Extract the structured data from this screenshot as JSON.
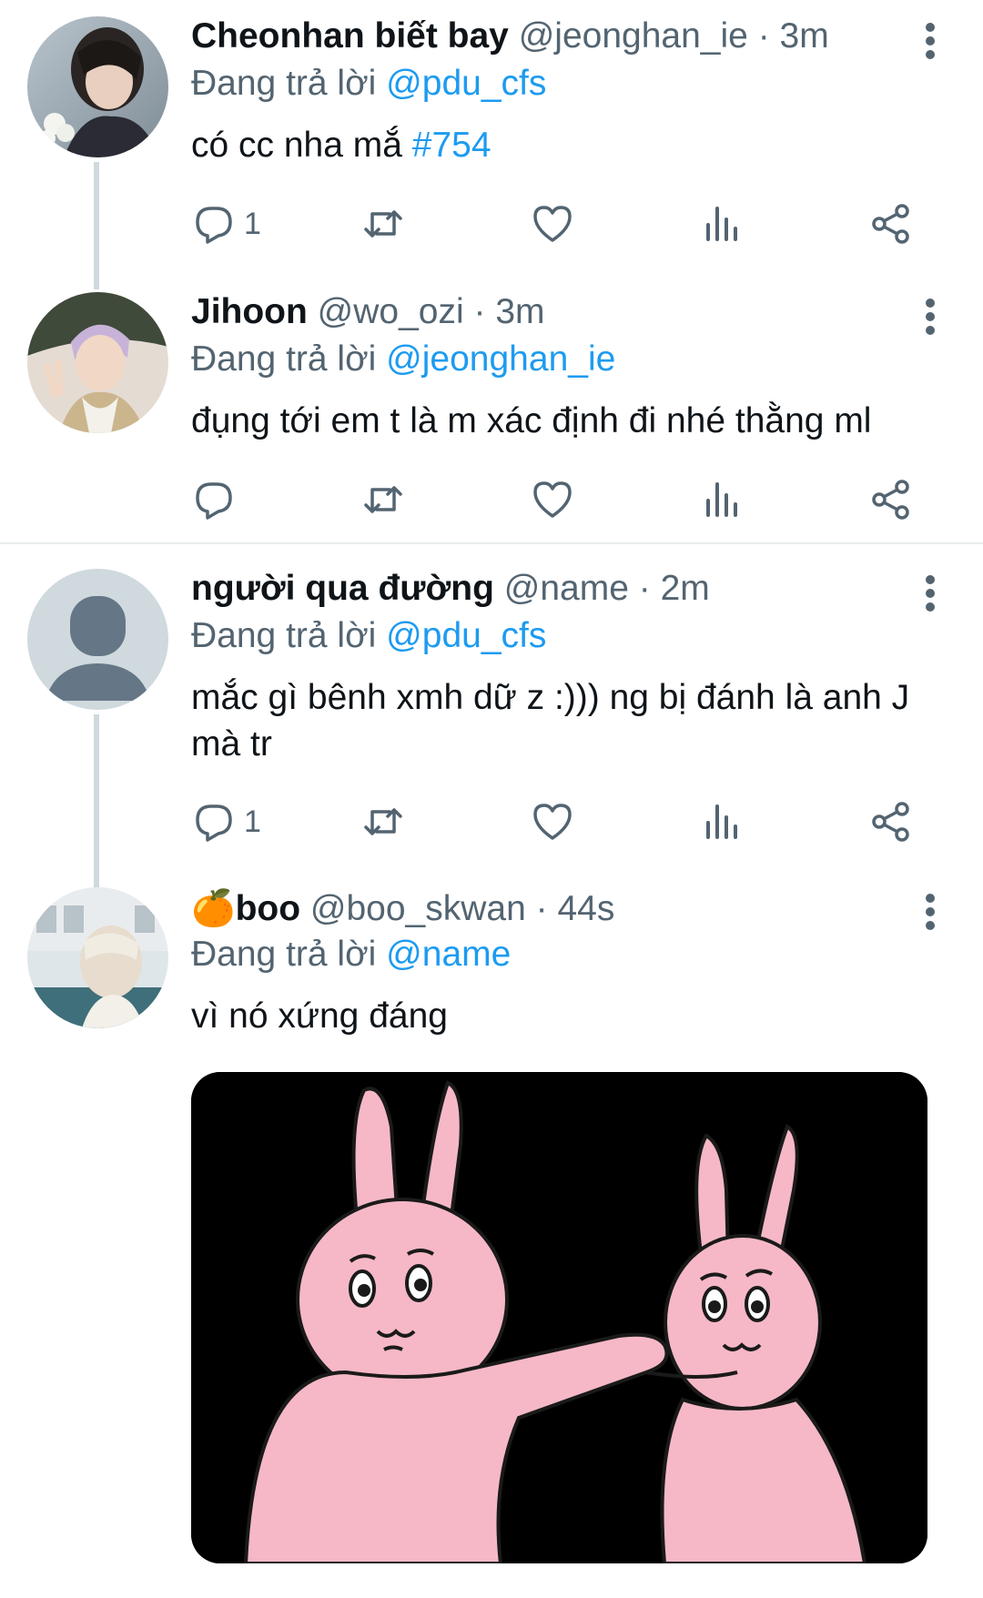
{
  "tweets": [
    {
      "display_name": "Cheonhan biết bay",
      "handle": "@jeonghan_ie",
      "time": "3m",
      "reply_prefix": "Đang trả lời",
      "reply_to": "@pdu_cfs",
      "text": "có cc nha mắ",
      "hashtag": "#754",
      "reply_count": "1"
    },
    {
      "display_name": "Jihoon",
      "handle": "@wo_ozi",
      "time": "3m",
      "reply_prefix": "Đang trả lời",
      "reply_to": "@jeonghan_ie",
      "text": "đụng tới em t là m xác định đi nhé thằng ml",
      "reply_count": ""
    },
    {
      "display_name": "người qua đường",
      "handle": "@name",
      "time": "2m",
      "reply_prefix": "Đang trả lời",
      "reply_to": "@pdu_cfs",
      "text": "mắc gì bênh xmh dữ z :))) ng bị đánh là anh J mà tr",
      "reply_count": "1"
    },
    {
      "display_name_emoji": "🍊",
      "display_name": "boo",
      "handle": "@boo_skwan",
      "time": "44s",
      "reply_prefix": "Đang trả lời",
      "reply_to": "@name",
      "text": "vì nó xứng đáng"
    }
  ],
  "separator": "·",
  "icons": {
    "more": "more-vertical-icon",
    "reply": "reply-icon",
    "retweet": "retweet-icon",
    "like": "heart-icon",
    "views": "views-chart-icon",
    "share": "share-icon"
  },
  "colors": {
    "accent": "#1d9bf0",
    "text": "#0f1419",
    "secondary": "#536471",
    "thread_line": "#cfd9de",
    "media_bunny_pink": "#f6b8c6"
  }
}
